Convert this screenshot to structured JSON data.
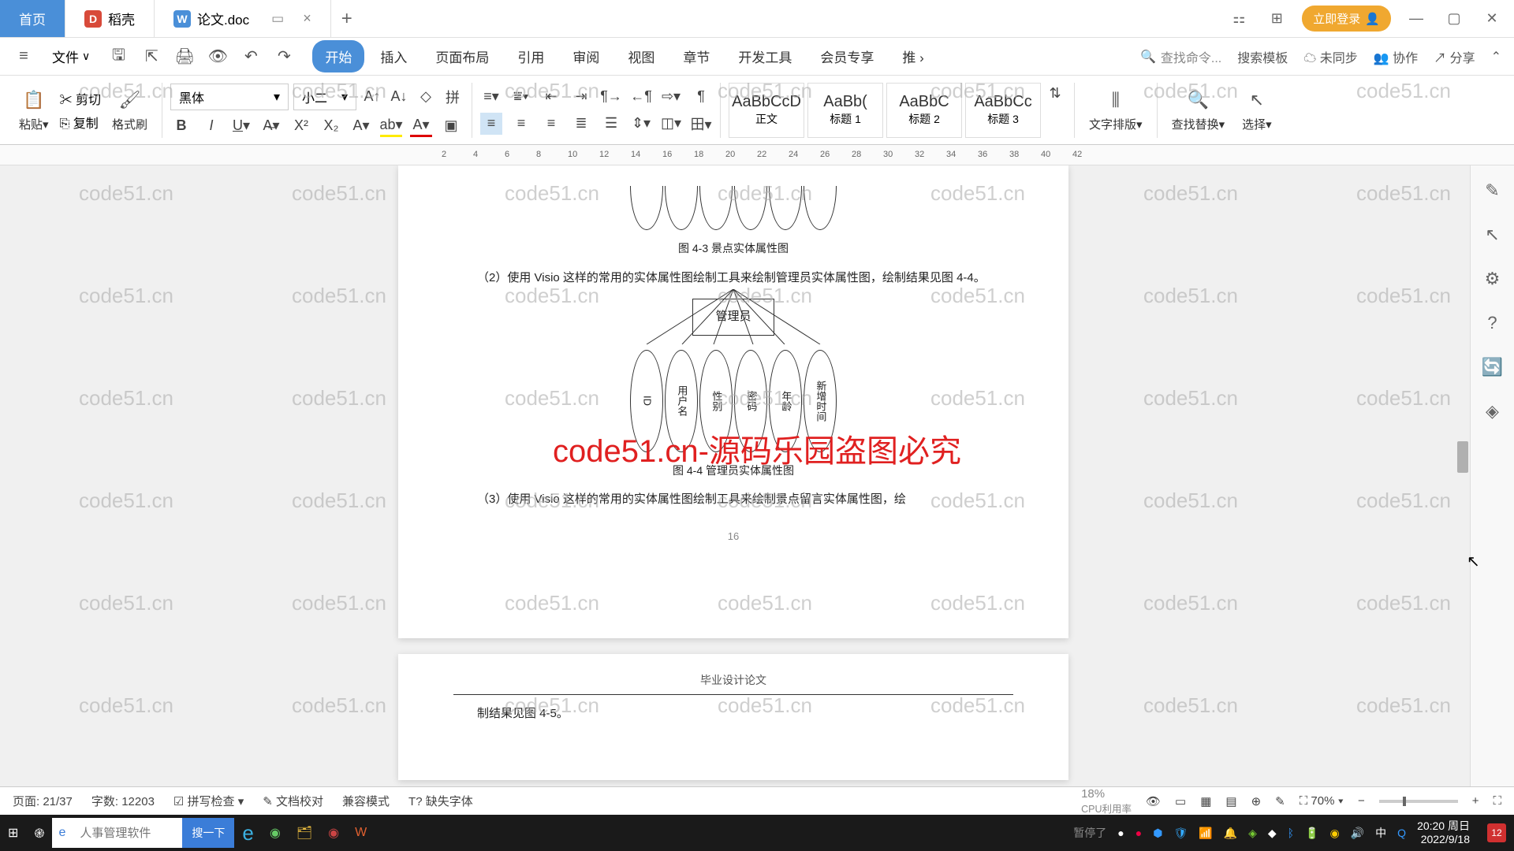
{
  "tabs": {
    "home": "首页",
    "docker": "稻壳",
    "doc": "论文.doc"
  },
  "titleRight": {
    "login": "立即登录"
  },
  "fileMenu": "文件",
  "menus": [
    "开始",
    "插入",
    "页面布局",
    "引用",
    "审阅",
    "视图",
    "章节",
    "开发工具",
    "会员专享",
    "推"
  ],
  "menuRight": {
    "searchCmd": "查找命令...",
    "searchTpl": "搜索模板",
    "sync": "未同步",
    "collab": "协作",
    "share": "分享"
  },
  "ribbon": {
    "cut": "剪切",
    "copy": "复制",
    "paste": "粘贴",
    "format": "格式刷",
    "font": "黑体",
    "size": "小二",
    "styles": [
      {
        "prev": "AaBbCcD",
        "name": "正文"
      },
      {
        "prev": "AaBb(",
        "name": "标题 1"
      },
      {
        "prev": "AaBbC",
        "name": "标题 2"
      },
      {
        "prev": "AaBbCc",
        "name": "标题 3"
      }
    ],
    "textLayout": "文字排版",
    "findReplace": "查找替换",
    "select": "选择"
  },
  "doc": {
    "cap43": "图 4-3 景点实体属性图",
    "para2": "（2）使用 Visio 这样的常用的实体属性图绘制工具来绘制管理员实体属性图，绘制结果见图 4-4。",
    "entity": "管理员",
    "attrs": [
      "ID",
      "用户名",
      "性别",
      "密码",
      "年龄",
      "新增时间"
    ],
    "cap44": "图 4-4 管理员实体属性图",
    "para3": "（3）使用 Visio 这样的常用的实体属性图绘制工具来绘制景点留言实体属性图，绘",
    "pgnum": "16",
    "hdr2": "毕业设计论文",
    "para4": "制结果见图 4-5。"
  },
  "wmRed": "code51.cn-源码乐园盗图必究",
  "wmGrey": "code51.cn",
  "status": {
    "page": "页面: 21/37",
    "words": "字数: 12203",
    "spell": "拼写检查",
    "proof": "文档校对",
    "compat": "兼容模式",
    "missingFont": "缺失字体",
    "zoom": "70%",
    "cpu": "CPU利用率",
    "pct": "18%",
    "paused": "暂停了"
  },
  "taskbar": {
    "searchPh": "人事管理软件",
    "searchBtn": "搜一下",
    "time": "20:20 周日",
    "date": "2022/9/18",
    "notif": "12",
    "ime": "中"
  }
}
